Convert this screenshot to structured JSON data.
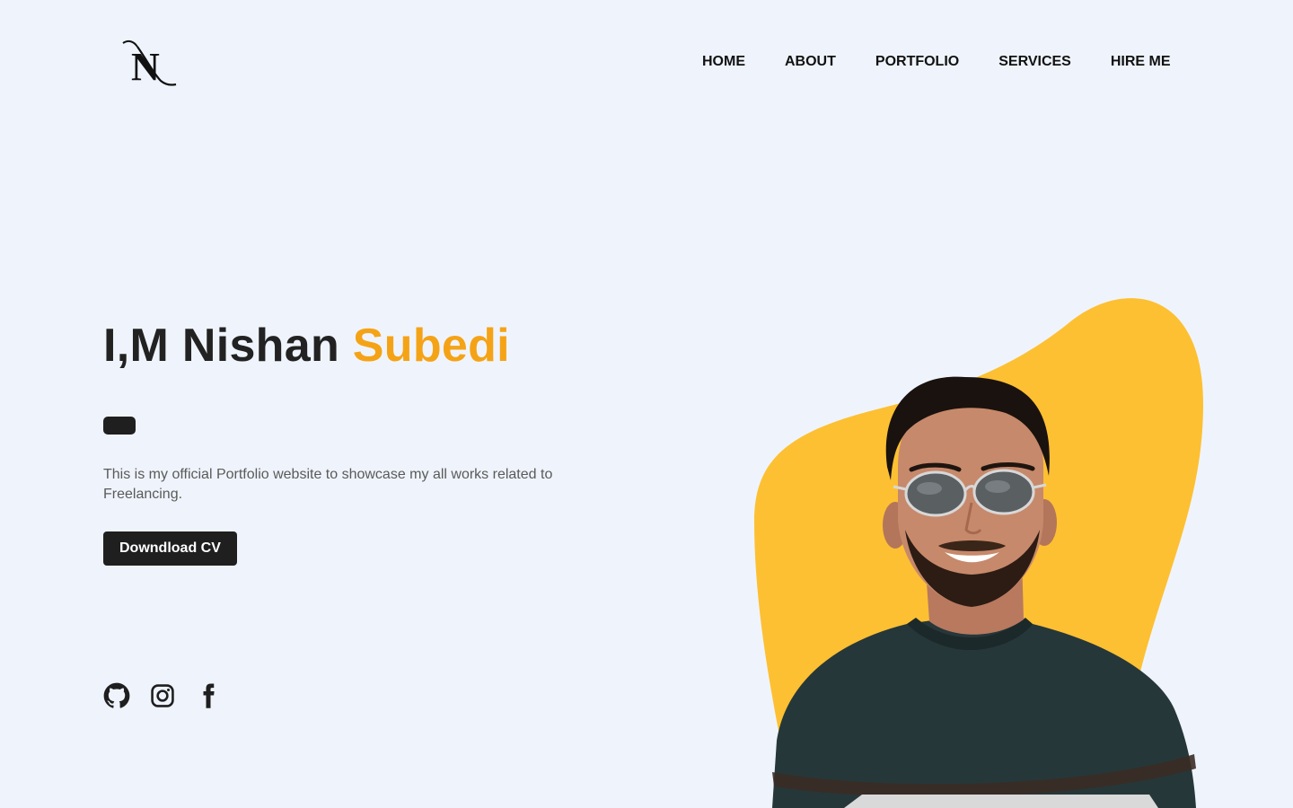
{
  "header": {
    "logo_letter": "N",
    "nav": [
      {
        "label": "HOME"
      },
      {
        "label": "ABOUT"
      },
      {
        "label": "PORTFOLIO"
      },
      {
        "label": "SERVICES"
      },
      {
        "label": "HIRE ME"
      }
    ]
  },
  "hero": {
    "title_prefix": "I,M Nishan",
    "title_accent": "Subedi",
    "description": "This is my official Portfolio website to showcase my all works related to Freelancing.",
    "cta_label": "Downdload CV"
  },
  "socials": [
    {
      "icon": "github-icon"
    },
    {
      "icon": "instagram-icon"
    },
    {
      "icon": "facebook-icon"
    }
  ],
  "colors": {
    "background": "#eff4fc",
    "accent": "#f5a316",
    "blob": "#fdc032",
    "dark": "#1f1f1f"
  }
}
